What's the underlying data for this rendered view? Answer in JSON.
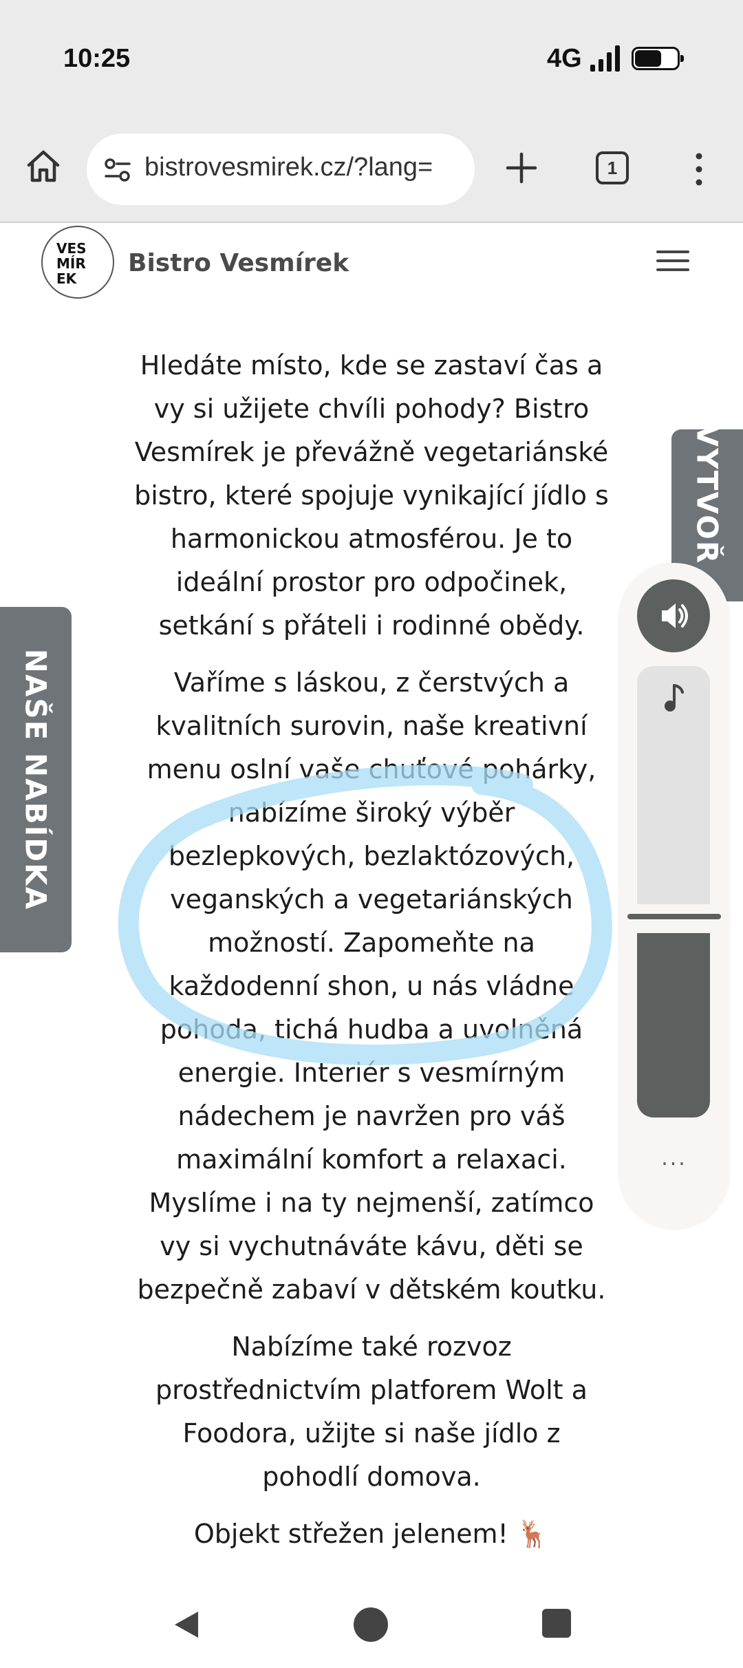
{
  "status_bar": {
    "time": "10:25",
    "network": "4G"
  },
  "browser": {
    "url": "bistrovesmirek.cz/?lang=",
    "tab_count": "1"
  },
  "site": {
    "logo_lines": [
      "VES",
      "MÍR",
      "EK"
    ],
    "title": "Bistro Vesmírek"
  },
  "content": {
    "paragraphs": [
      "Hledáte místo, kde se zastaví čas a vy si užijete chvíli pohody? Bistro Vesmírek je převážně vegetariánské bistro, které spojuje vynikající jídlo s harmonickou atmosférou. Je to ideální prostor pro odpočinek, setkání s přáteli i rodinné obědy.",
      "Vaříme s láskou, z čerstvých a kvalitních surovin, naše kreativní menu oslní vaše chuťové pohárky, nabízíme široký výběr bezlepkových, bezlaktózových, veganských a vegetariánských možností. Zapomeňte na každodenní shon, u nás vládne pohoda, tichá hudba a uvolněná energie. Interiér s vesmírným nádechem je navržen pro váš maximální komfort a relaxaci. Myslíme i na ty nejmenší, zatímco vy si vychutnáváte kávu, děti se bezpečně zabaví v dětském koutku.",
      "Nabízíme také rozvoz prostřednictvím platforem Wolt a Foodora, užijte si naše jídlo z pohodlí domova.",
      "Objekt střežen jelenem! 🦌"
    ]
  },
  "side_tabs": {
    "left": "NAŠE NABÍDKA",
    "right": "VYTVOŘ"
  },
  "volume_panel": {
    "more_label": "...",
    "music_level": 0.33
  },
  "colors": {
    "accent_gray": "#6f7478",
    "highlight_circle": "#a8dcf5"
  }
}
